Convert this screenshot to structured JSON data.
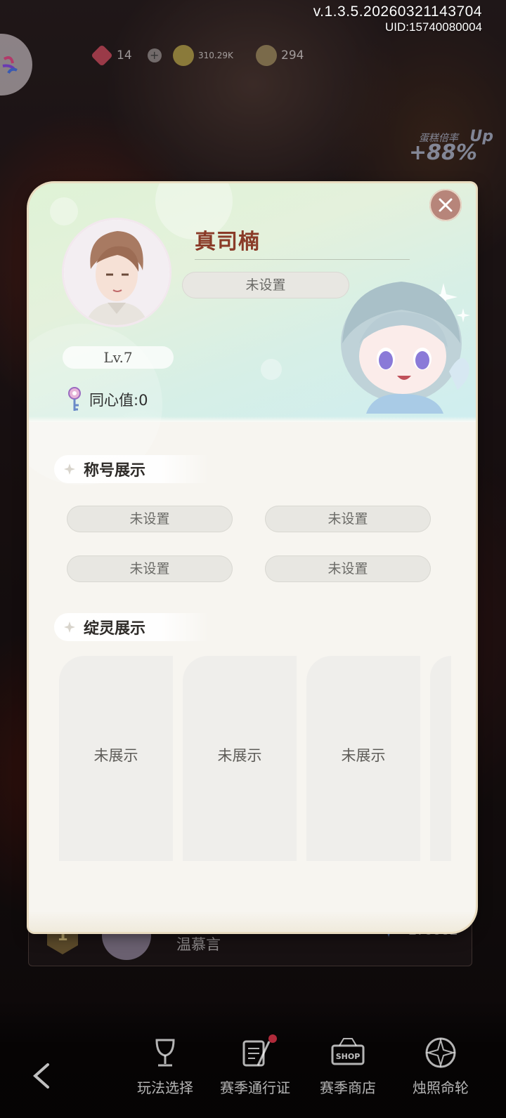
{
  "version": {
    "build": "v.1.3.5.20260321143704",
    "uid": "UID:15740080004"
  },
  "currency": {
    "gems": "14",
    "gold": "310.29K",
    "coins": "294"
  },
  "boost": {
    "label": "蛋糕倍率",
    "suffix": "Up",
    "value": "+88%"
  },
  "profile": {
    "name": "真司楠",
    "signature": "未设置",
    "level": "Lv.7",
    "bond": "同心值:0"
  },
  "titles_section": {
    "heading": "称号展示",
    "slots": [
      "未设置",
      "未设置",
      "未设置",
      "未设置"
    ]
  },
  "spirits_section": {
    "heading": "绽灵展示",
    "slots": [
      "未展示",
      "未展示",
      "未展示"
    ]
  },
  "ranking_row": {
    "rank": "1",
    "name": "温慕言",
    "score": "179961"
  },
  "bottom_nav": [
    {
      "label": "玩法选择",
      "icon": "chalice-icon"
    },
    {
      "label": "赛季通行证",
      "icon": "scroll-quill-icon",
      "has_dot": true
    },
    {
      "label": "赛季商店",
      "icon": "shop-sign-icon"
    },
    {
      "label": "烛照命轮",
      "icon": "compass-wheel-icon"
    }
  ],
  "colors": {
    "name_color": "#8a3b28",
    "close_button": "#b7857a",
    "header_green": "#dff3d6",
    "notification_dot": "#b02a3a"
  }
}
